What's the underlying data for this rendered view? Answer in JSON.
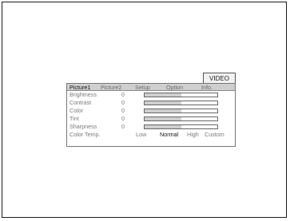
{
  "screen": {
    "mode_tab": "VIDEO",
    "tabs": [
      {
        "label": "Picture1",
        "active": true
      },
      {
        "label": "Picture2",
        "active": false
      },
      {
        "label": "Setup",
        "active": false
      },
      {
        "label": "Option",
        "active": false
      },
      {
        "label": "Info.",
        "active": false
      }
    ],
    "settings": [
      {
        "label": "Brightness",
        "value": "0",
        "level": 0.5
      },
      {
        "label": "Contrast",
        "value": "0",
        "level": 0.5
      },
      {
        "label": "Color",
        "value": "0",
        "level": 0.5
      },
      {
        "label": "Tint",
        "value": "0",
        "level": 0.5
      },
      {
        "label": "Sharpness",
        "value": "0",
        "level": 0.5
      }
    ],
    "color_temp": {
      "label": "Color Temp.",
      "options": [
        "Low",
        "Normal",
        "High",
        "Custom"
      ],
      "selected": "Normal"
    }
  }
}
